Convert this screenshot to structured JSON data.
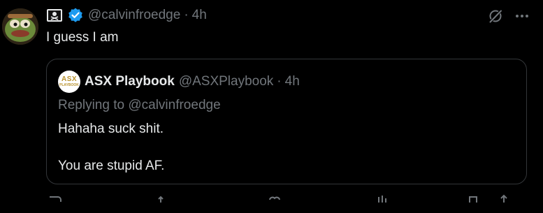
{
  "tweet": {
    "badge_icon": "pirate-flag-icon",
    "verified_icon": "verified-badge-icon",
    "handle": "@calvinfroedge",
    "separator": "·",
    "time": "4h",
    "grok_icon": "grok-icon",
    "more_icon": "more-icon",
    "text": "I guess I am"
  },
  "quote": {
    "avatar_line1": "ASX",
    "avatar_line2": "PLAYBOOK",
    "display_name": "ASX Playbook",
    "handle": "@ASXPlaybook",
    "separator": "·",
    "time": "4h",
    "replying_to": "Replying to @calvinfroedge",
    "line1": "Hahaha suck shit.",
    "line2": "You are stupid AF."
  },
  "colors": {
    "background": "#000000",
    "text_primary": "#e7e9ea",
    "text_secondary": "#71767b",
    "border": "#333639",
    "verified_blue": "#1d9bf0"
  }
}
